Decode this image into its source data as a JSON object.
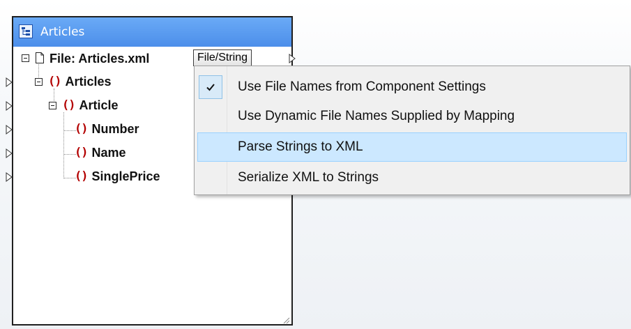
{
  "component": {
    "title": "Articles",
    "header_color": "#5a9bf0",
    "file_node": {
      "label": "File: Articles.xml",
      "file_string_button": "File/String"
    },
    "tree": [
      {
        "label": "Articles",
        "icon": "element-icon"
      },
      {
        "label": "Article",
        "icon": "element-icon"
      },
      {
        "label": "Number",
        "icon": "element-icon"
      },
      {
        "label": "Name",
        "icon": "element-icon"
      },
      {
        "label": "SinglePrice",
        "icon": "element-icon"
      }
    ]
  },
  "context_menu": {
    "items": [
      {
        "label": "Use File Names from Component Settings",
        "checked": true
      },
      {
        "label": "Use Dynamic File Names Supplied by Mapping",
        "checked": false
      },
      {
        "label": "Parse Strings to XML",
        "checked": false,
        "highlighted": true
      },
      {
        "label": "Serialize XML to Strings",
        "checked": false
      }
    ],
    "highlight_color": "#cce8ff"
  }
}
